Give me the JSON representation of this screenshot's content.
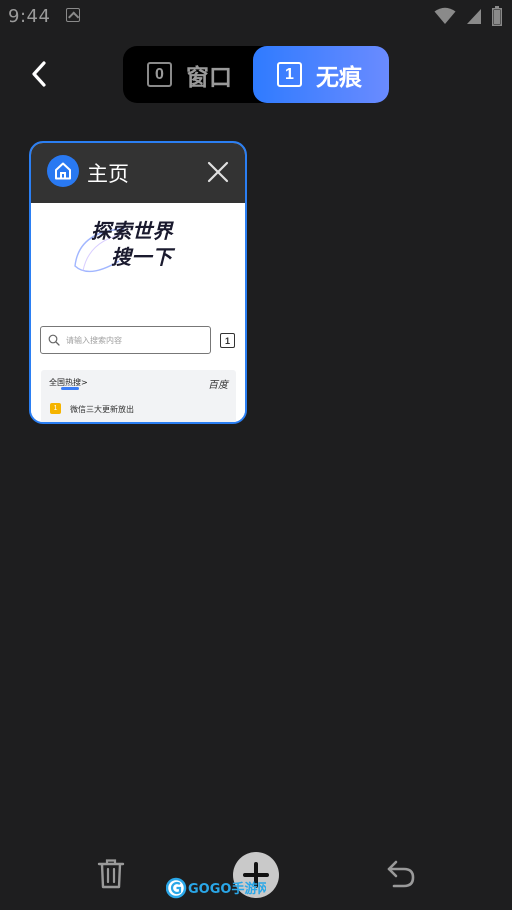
{
  "status_bar": {
    "time": "9:44",
    "icons": [
      "app-notification-icon",
      "wifi-icon",
      "signal-icon",
      "battery-icon"
    ]
  },
  "header": {
    "back_icon": "chevron-left-icon",
    "tabs": [
      {
        "count": "0",
        "label": "窗口",
        "active": false
      },
      {
        "count": "1",
        "label": "无痕",
        "active": true
      }
    ]
  },
  "tab_card": {
    "title": "主页",
    "icon": "home-icon",
    "close_icon": "close-icon",
    "preview": {
      "hero_line1": "探索世界",
      "hero_line2": "搜一下",
      "search_placeholder": "请输入搜索内容",
      "tab_count": "1",
      "hot_title": "全国热搜>",
      "hot_source": "百度",
      "hot_items": [
        {
          "rank": "1",
          "text": "微信三大更新放出"
        }
      ]
    }
  },
  "toolbar": {
    "trash_icon": "trash-icon",
    "add_icon": "plus-icon",
    "undo_icon": "undo-icon"
  },
  "watermark": {
    "text": "GOGO手游网"
  },
  "colors": {
    "background": "#1e1e1f",
    "accent": "#2b7ff3",
    "incognito_gradient_start": "#2f7bff",
    "incognito_gradient_end": "#6a8bff",
    "card_header": "#333333"
  }
}
